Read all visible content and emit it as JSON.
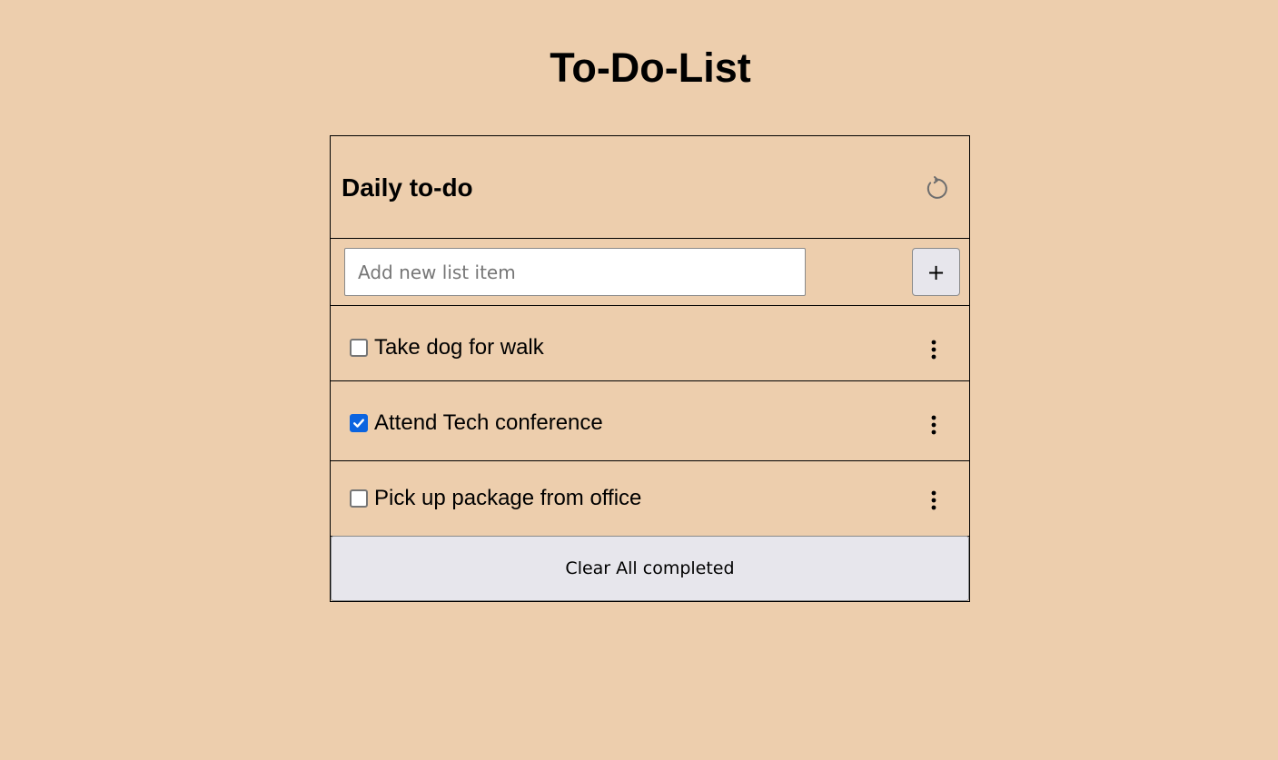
{
  "page": {
    "title": "To-Do-List",
    "background_color": "#edcead"
  },
  "card": {
    "title": "Daily to-do",
    "refresh_icon": "refresh-icon"
  },
  "add_item": {
    "value": "",
    "placeholder": "Add new list item",
    "button_label": "+"
  },
  "items": [
    {
      "label": "Take dog for walk",
      "checked": false,
      "menu_icon": "kebab-menu-icon"
    },
    {
      "label": "Attend Tech conference",
      "checked": true,
      "menu_icon": "kebab-menu-icon"
    },
    {
      "label": "Pick up package from office",
      "checked": false,
      "menu_icon": "kebab-menu-icon"
    }
  ],
  "footer": {
    "clear_label": "Clear All completed"
  },
  "colors": {
    "checkbox_checked": "#0b64e0",
    "button_bg": "#e7e6ec"
  }
}
